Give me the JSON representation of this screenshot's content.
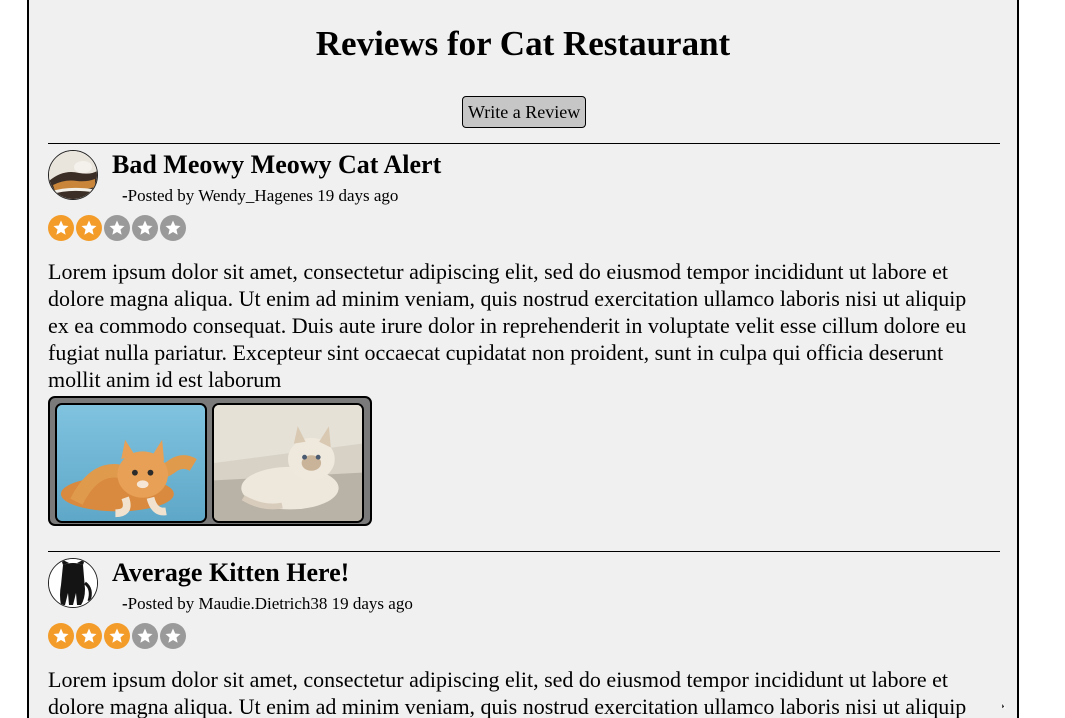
{
  "page": {
    "title": "Reviews for Cat Restaurant",
    "write_review_label": "Write a Review"
  },
  "colors": {
    "star_on": "#f39c2a",
    "star_off": "#9a9a9a",
    "panel_bg": "#f0f0f0",
    "button_bg": "#c6c6c6"
  },
  "reviews": [
    {
      "title": "Bad Meowy Meowy Cat Alert",
      "posted_prefix": "-",
      "posted_text": "Posted by Wendy_Hagenes 19 days ago",
      "rating": 2,
      "rating_max": 5,
      "avatar_icon": "cat-avatar-icon",
      "body": "Lorem ipsum dolor sit amet, consectetur adipiscing elit, sed do eiusmod tempor incididunt ut labore et dolore magna aliqua. Ut enim ad minim veniam, quis nostrud exercitation ullamco laboris nisi ut aliquip ex ea commodo consequat. Duis aute irure dolor in reprehenderit in voluptate velit esse cillum dolore eu fugiat nulla pariatur. Excepteur sint occaecat cupidatat non proident, sunt in culpa qui officia deserunt mollit anim id est laborum",
      "photos": [
        "orange-kitten-photo",
        "fluffy-cat-photo"
      ]
    },
    {
      "title": "Average Kitten Here!",
      "posted_prefix": "-",
      "posted_text": "Posted by Maudie.Dietrich38 19 days ago",
      "rating": 3,
      "rating_max": 5,
      "avatar_icon": "black-cat-avatar-icon",
      "body": "Lorem ipsum dolor sit amet, consectetur adipiscing elit, sed do eiusmod tempor incididunt ut labore et dolore magna aliqua. Ut enim ad minim veniam, quis nostrud exercitation ullamco laboris nisi ut aliquip ex ea commodo consequat."
    }
  ]
}
